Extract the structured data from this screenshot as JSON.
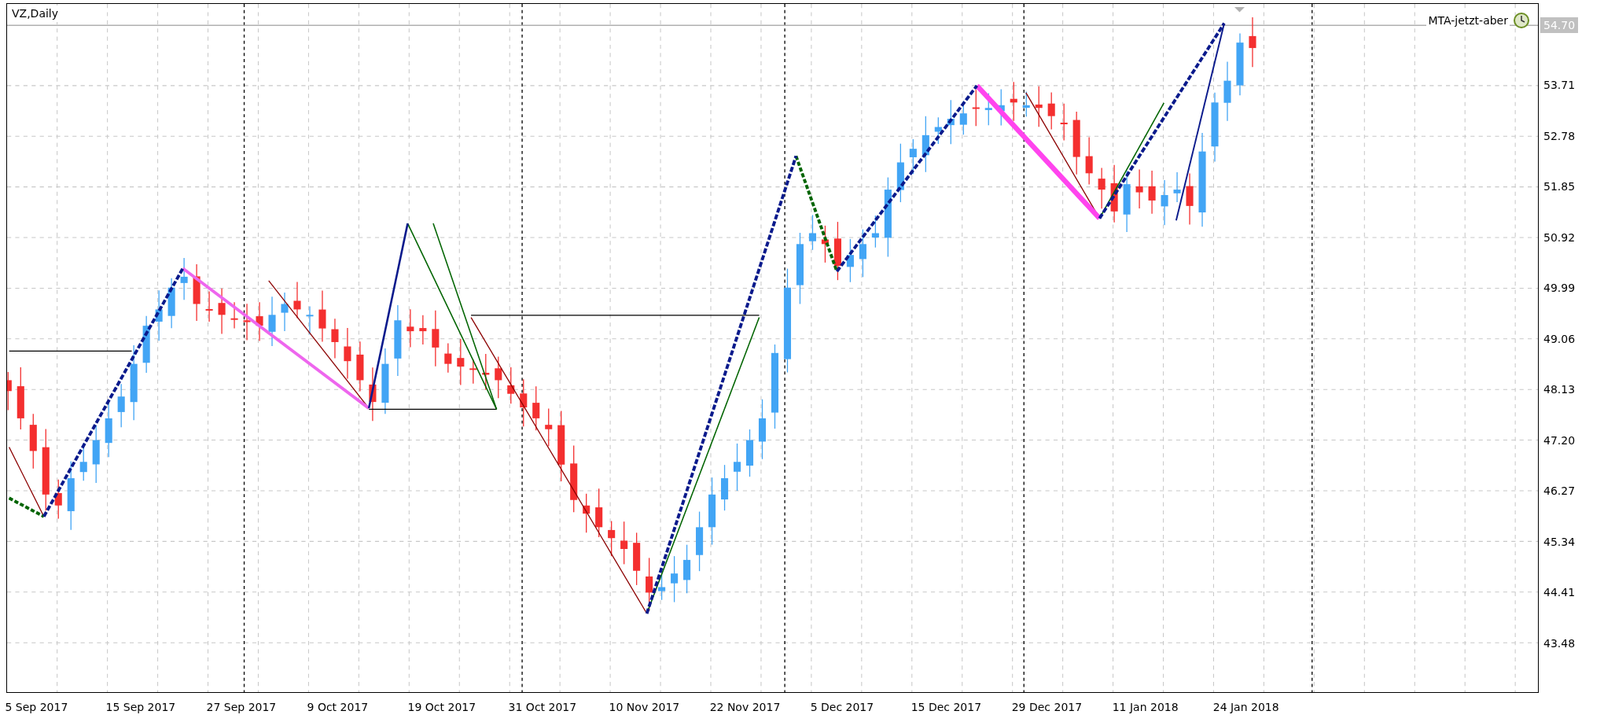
{
  "chart": {
    "symbol_label": "VZ,Daily",
    "indicator_label": "MTA-jetzt-aber",
    "current_price": "54.70",
    "price_labels": [
      "53.71",
      "52.78",
      "51.85",
      "50.92",
      "49.99",
      "49.06",
      "48.13",
      "47.20",
      "46.27",
      "45.34",
      "44.41",
      "43.48"
    ],
    "date_labels": [
      "5 Sep 2017",
      "15 Sep 2017",
      "27 Sep 2017",
      "9 Oct 2017",
      "19 Oct 2017",
      "31 Oct 2017",
      "10 Nov 2017",
      "22 Nov 2017",
      "5 Dec 2017",
      "15 Dec 2017",
      "29 Dec 2017",
      "11 Jan 2018",
      "24 Jan 2018"
    ]
  }
}
